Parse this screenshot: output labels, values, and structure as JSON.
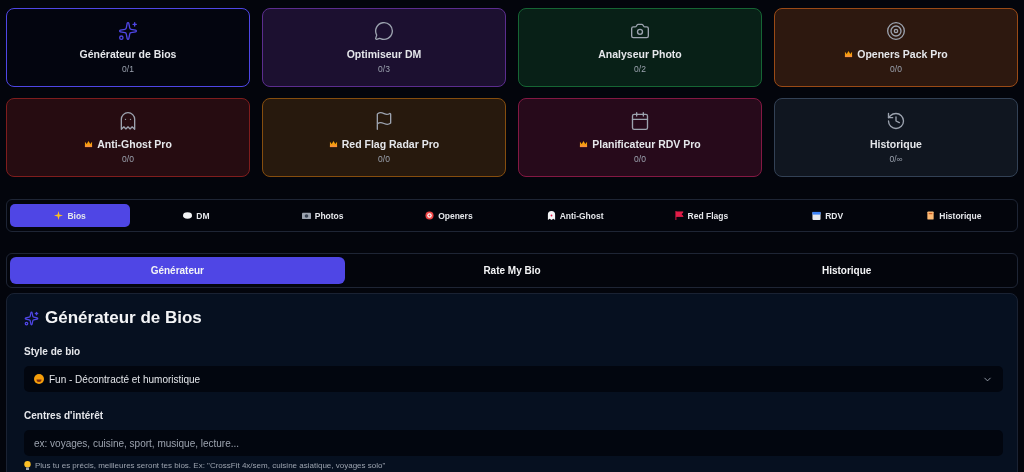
{
  "tools": [
    {
      "title": "Générateur de Bios",
      "count": "0/1",
      "selected": true,
      "pro": false,
      "color": "#4f46e5"
    },
    {
      "title": "Optimiseur DM",
      "count": "0/3",
      "selected": false,
      "pro": false,
      "color": "#5b2d8e"
    },
    {
      "title": "Analyseur Photo",
      "count": "0/2",
      "selected": false,
      "pro": false,
      "color": "#166534"
    },
    {
      "title": "Openers Pack Pro",
      "count": "0/0",
      "selected": false,
      "pro": true,
      "color": "#9a4a16"
    },
    {
      "title": "Anti-Ghost Pro",
      "count": "0/0",
      "selected": false,
      "pro": true,
      "color": "#7f1d1d"
    },
    {
      "title": "Red Flag Radar Pro",
      "count": "0/0",
      "selected": false,
      "pro": true,
      "color": "#854d0e"
    },
    {
      "title": "Planificateur RDV Pro",
      "count": "0/0",
      "selected": false,
      "pro": true,
      "color": "#831843"
    },
    {
      "title": "Historique",
      "count": "0/∞",
      "selected": false,
      "pro": false,
      "color": "#334155"
    }
  ],
  "nav_tabs": [
    {
      "label": "Bios",
      "selected": true
    },
    {
      "label": "DM",
      "selected": false
    },
    {
      "label": "Photos",
      "selected": false
    },
    {
      "label": "Openers",
      "selected": false
    },
    {
      "label": "Anti-Ghost",
      "selected": false
    },
    {
      "label": "Red Flags",
      "selected": false
    },
    {
      "label": "RDV",
      "selected": false
    },
    {
      "label": "Historique",
      "selected": false
    }
  ],
  "sub_tabs": [
    {
      "label": "Générateur",
      "selected": true
    },
    {
      "label": "Rate My Bio",
      "selected": false
    },
    {
      "label": "Historique",
      "selected": false
    }
  ],
  "panel": {
    "title": "Générateur de Bios",
    "style_field": {
      "label": "Style de bio",
      "value": "Fun - Décontracté et humoristique"
    },
    "interests_field": {
      "label": "Centres d'intérêt",
      "placeholder": "ex: voyages, cuisine, sport, musique, lecture...",
      "hint": "Plus tu es précis, meilleures seront tes bios. Ex: \"CrossFit 4x/sem, cuisine asiatique, voyages solo\""
    }
  }
}
